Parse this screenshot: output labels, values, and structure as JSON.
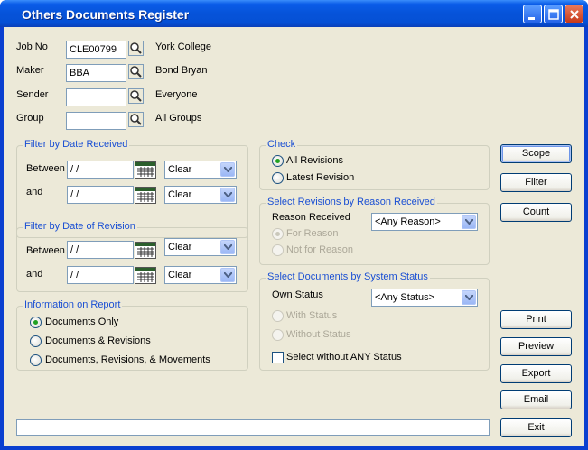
{
  "window": {
    "title": "Others Documents Register"
  },
  "fields": [
    {
      "label": "Job No",
      "value": "CLE00799",
      "desc": "York College"
    },
    {
      "label": "Maker",
      "value": "BBA",
      "desc": "Bond Bryan"
    },
    {
      "label": "Sender",
      "value": "",
      "desc": "Everyone"
    },
    {
      "label": "Group",
      "value": "",
      "desc": "All Groups"
    }
  ],
  "date_received": {
    "title": "Filter by Date Received",
    "between_label": "Between",
    "and_label": "and",
    "between_value": " / /",
    "and_value": " / /",
    "between_combo": "Clear",
    "and_combo": "Clear"
  },
  "date_revision": {
    "title": "Filter by Date of Revision",
    "between_label": "Between",
    "and_label": "and",
    "between_value": " / /",
    "and_value": " / /",
    "between_combo": "Clear",
    "and_combo": "Clear"
  },
  "info_report": {
    "title": "Information on Report",
    "options": [
      "Documents Only",
      "Documents & Revisions",
      "Documents, Revisions, & Movements"
    ],
    "selected": 0
  },
  "check": {
    "title": "Check",
    "options": [
      "All Revisions",
      "Latest Revision"
    ],
    "selected": 0
  },
  "reason": {
    "title": "Select Revisions by Reason Received",
    "label": "Reason Received",
    "combo": "<Any Reason>",
    "options": [
      "For Reason",
      "Not for Reason"
    ]
  },
  "status": {
    "title": "Select Documents by System Status",
    "label": "Own Status",
    "combo": "<Any Status>",
    "options": [
      "With Status",
      "Without Status"
    ],
    "checkbox": "Select without ANY Status"
  },
  "buttons": {
    "scope": "Scope",
    "filter": "Filter",
    "count": "Count",
    "print": "Print",
    "preview": "Preview",
    "export": "Export",
    "email": "Email",
    "exit": "Exit"
  }
}
